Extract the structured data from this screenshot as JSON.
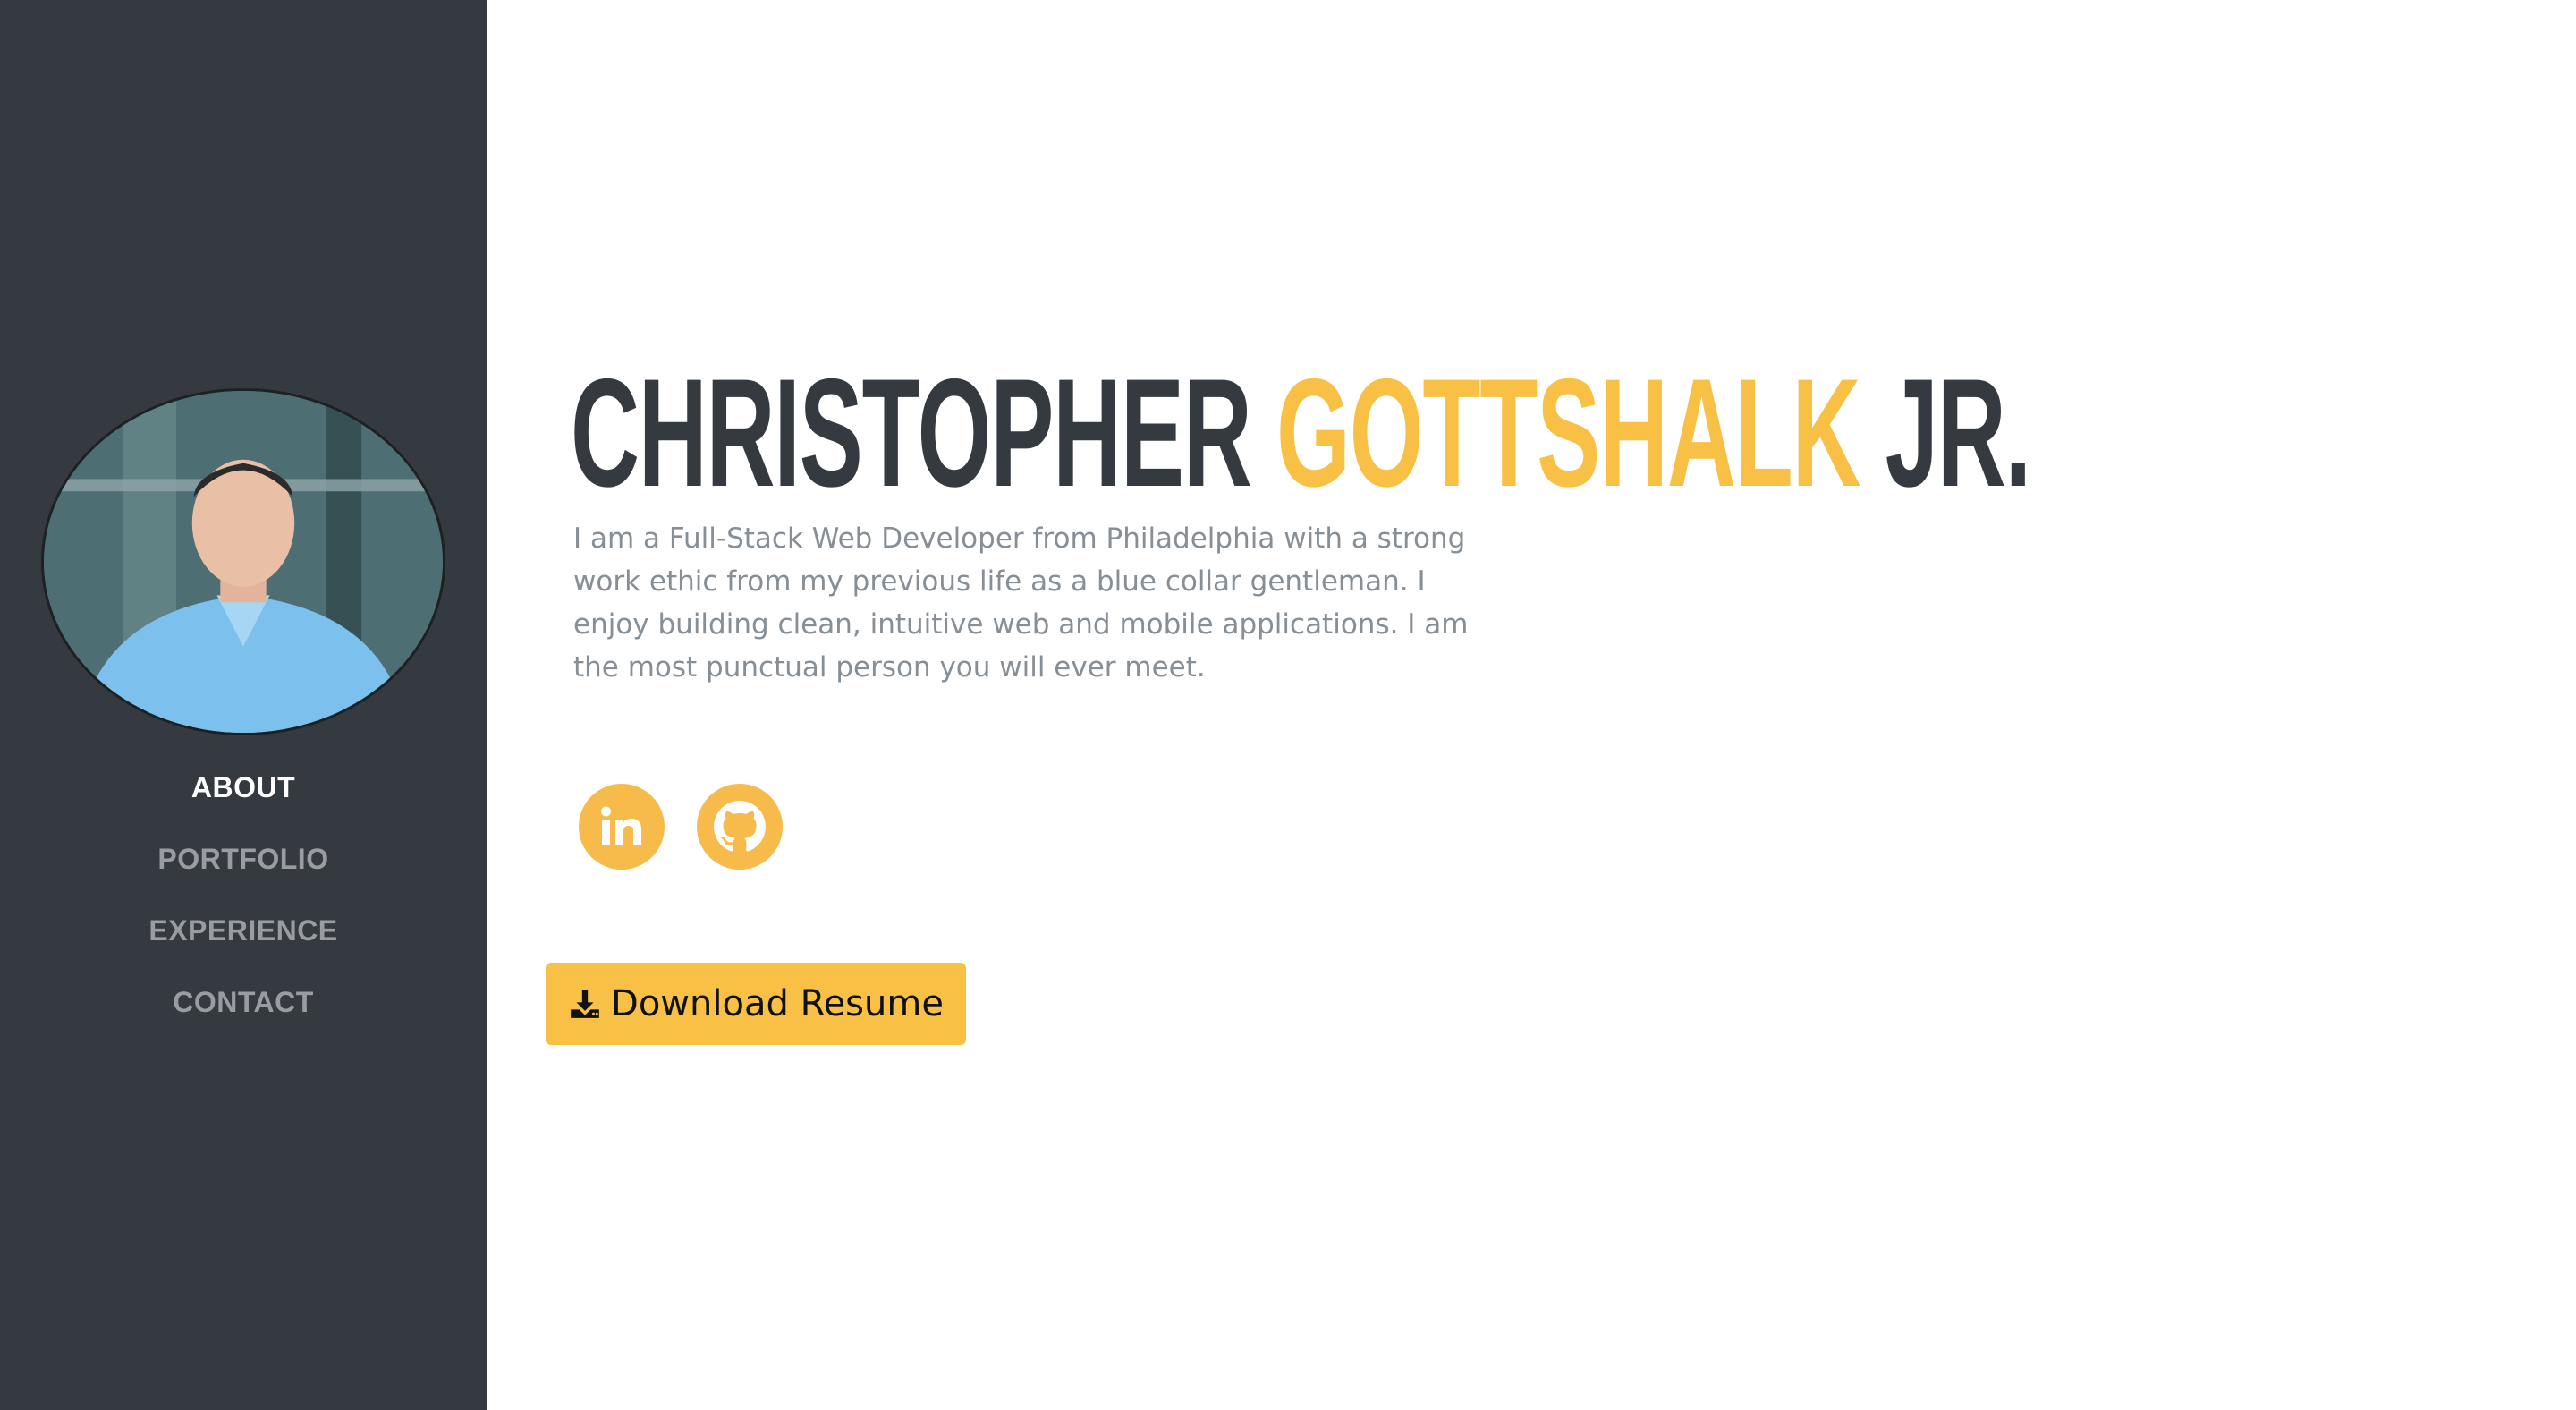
{
  "profile": {
    "first_name": "CHRISTOPHER",
    "last_name": "GOTTSHALK",
    "suffix": "JR.",
    "bio": "I am a Full-Stack Web Developer from Philadelphia with a strong work ethic from my previous life as a blue collar gentleman. I enjoy building clean, intuitive web and mobile applications. I am the most punctual person you will ever meet."
  },
  "nav": {
    "items": [
      {
        "label": "ABOUT",
        "active": true
      },
      {
        "label": "PORTFOLIO",
        "active": false
      },
      {
        "label": "EXPERIENCE",
        "active": false
      },
      {
        "label": "CONTACT",
        "active": false
      }
    ]
  },
  "social": {
    "links": [
      {
        "icon": "linkedin-icon"
      },
      {
        "icon": "github-icon"
      }
    ]
  },
  "actions": {
    "download_label": "Download Resume",
    "download_icon": "download-icon"
  },
  "colors": {
    "sidebar": "#343a40",
    "accent": "#f8c146",
    "heading": "#343a40",
    "body_text": "#868e96"
  }
}
